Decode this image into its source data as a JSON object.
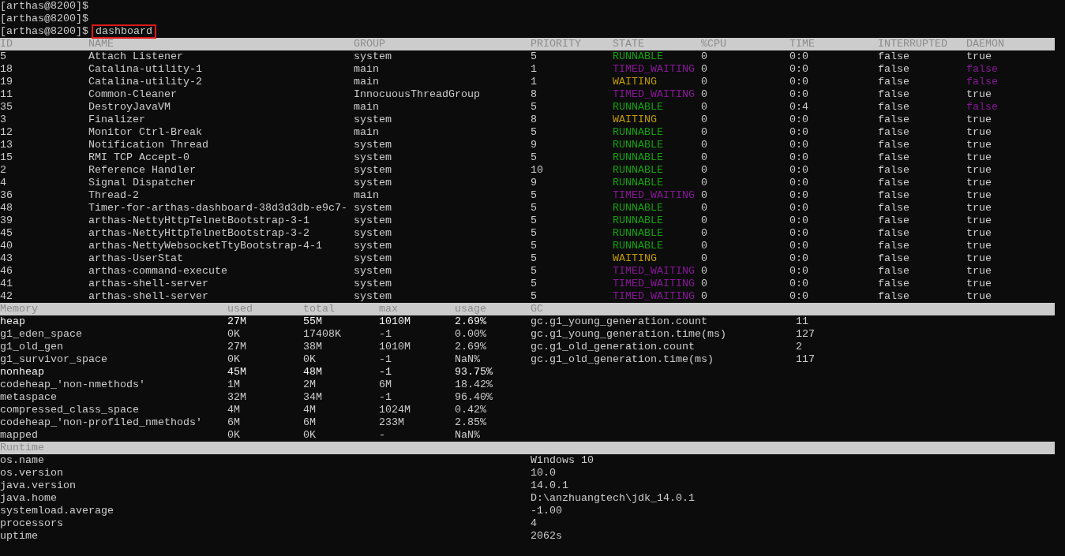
{
  "prompts": [
    {
      "prompt": "[arthas@8200]$"
    },
    {
      "prompt": "[arthas@8200]$"
    },
    {
      "prompt": "[arthas@8200]$",
      "command": "dashboard",
      "boxed": true
    }
  ],
  "threads": {
    "columns": [
      "ID",
      "NAME",
      "GROUP",
      "PRIORITY",
      "STATE",
      "%CPU",
      "TIME",
      "INTERRUPTED",
      "DAEMON"
    ],
    "rows": [
      {
        "id": "5",
        "name": "Attach Listener",
        "group": "system",
        "priority": "5",
        "state": {
          "text": "RUNNABLE",
          "color": "#13a10e"
        },
        "cpu": "0",
        "time": "0:0",
        "interrupted": "false",
        "daemon": {
          "text": "true",
          "color": "#cccccc"
        }
      },
      {
        "id": "18",
        "name": "Catalina-utility-1",
        "group": "main",
        "priority": "1",
        "state": {
          "text": "TIMED_WAITING",
          "color": "#881798"
        },
        "cpu": "0",
        "time": "0:0",
        "interrupted": "false",
        "daemon": {
          "text": "false",
          "color": "#881798"
        }
      },
      {
        "id": "19",
        "name": "Catalina-utility-2",
        "group": "main",
        "priority": "1",
        "state": {
          "text": "WAITING",
          "color": "#c19c00"
        },
        "cpu": "0",
        "time": "0:0",
        "interrupted": "false",
        "daemon": {
          "text": "false",
          "color": "#881798"
        }
      },
      {
        "id": "11",
        "name": "Common-Cleaner",
        "group": "InnocuousThreadGroup",
        "priority": "8",
        "state": {
          "text": "TIMED_WAITING",
          "color": "#881798"
        },
        "cpu": "0",
        "time": "0:0",
        "interrupted": "false",
        "daemon": {
          "text": "true",
          "color": "#cccccc"
        }
      },
      {
        "id": "35",
        "name": "DestroyJavaVM",
        "group": "main",
        "priority": "5",
        "state": {
          "text": "RUNNABLE",
          "color": "#13a10e"
        },
        "cpu": "0",
        "time": "0:4",
        "interrupted": "false",
        "daemon": {
          "text": "false",
          "color": "#881798"
        }
      },
      {
        "id": "3",
        "name": "Finalizer",
        "group": "system",
        "priority": "8",
        "state": {
          "text": "WAITING",
          "color": "#c19c00"
        },
        "cpu": "0",
        "time": "0:0",
        "interrupted": "false",
        "daemon": {
          "text": "true",
          "color": "#cccccc"
        }
      },
      {
        "id": "12",
        "name": "Monitor Ctrl-Break",
        "group": "main",
        "priority": "5",
        "state": {
          "text": "RUNNABLE",
          "color": "#13a10e"
        },
        "cpu": "0",
        "time": "0:0",
        "interrupted": "false",
        "daemon": {
          "text": "true",
          "color": "#cccccc"
        }
      },
      {
        "id": "13",
        "name": "Notification Thread",
        "group": "system",
        "priority": "9",
        "state": {
          "text": "RUNNABLE",
          "color": "#13a10e"
        },
        "cpu": "0",
        "time": "0:0",
        "interrupted": "false",
        "daemon": {
          "text": "true",
          "color": "#cccccc"
        }
      },
      {
        "id": "15",
        "name": "RMI TCP Accept-0",
        "group": "system",
        "priority": "5",
        "state": {
          "text": "RUNNABLE",
          "color": "#13a10e"
        },
        "cpu": "0",
        "time": "0:0",
        "interrupted": "false",
        "daemon": {
          "text": "true",
          "color": "#cccccc"
        }
      },
      {
        "id": "2",
        "name": "Reference Handler",
        "group": "system",
        "priority": "10",
        "state": {
          "text": "RUNNABLE",
          "color": "#13a10e"
        },
        "cpu": "0",
        "time": "0:0",
        "interrupted": "false",
        "daemon": {
          "text": "true",
          "color": "#cccccc"
        }
      },
      {
        "id": "4",
        "name": "Signal Dispatcher",
        "group": "system",
        "priority": "9",
        "state": {
          "text": "RUNNABLE",
          "color": "#13a10e"
        },
        "cpu": "0",
        "time": "0:0",
        "interrupted": "false",
        "daemon": {
          "text": "true",
          "color": "#cccccc"
        }
      },
      {
        "id": "36",
        "name": "Thread-2",
        "group": "main",
        "priority": "5",
        "state": {
          "text": "TIMED_WAITING",
          "color": "#881798"
        },
        "cpu": "0",
        "time": "0:0",
        "interrupted": "false",
        "daemon": {
          "text": "true",
          "color": "#cccccc"
        }
      },
      {
        "id": "48",
        "name": "Timer-for-arthas-dashboard-38d3d3db-e9c7-",
        "group": "system",
        "priority": "5",
        "state": {
          "text": "RUNNABLE",
          "color": "#13a10e"
        },
        "cpu": "0",
        "time": "0:0",
        "interrupted": "false",
        "daemon": {
          "text": "true",
          "color": "#cccccc"
        }
      },
      {
        "id": "39",
        "name": "arthas-NettyHttpTelnetBootstrap-3-1",
        "group": "system",
        "priority": "5",
        "state": {
          "text": "RUNNABLE",
          "color": "#13a10e"
        },
        "cpu": "0",
        "time": "0:0",
        "interrupted": "false",
        "daemon": {
          "text": "true",
          "color": "#cccccc"
        }
      },
      {
        "id": "45",
        "name": "arthas-NettyHttpTelnetBootstrap-3-2",
        "group": "system",
        "priority": "5",
        "state": {
          "text": "RUNNABLE",
          "color": "#13a10e"
        },
        "cpu": "0",
        "time": "0:0",
        "interrupted": "false",
        "daemon": {
          "text": "true",
          "color": "#cccccc"
        }
      },
      {
        "id": "40",
        "name": "arthas-NettyWebsocketTtyBootstrap-4-1",
        "group": "system",
        "priority": "5",
        "state": {
          "text": "RUNNABLE",
          "color": "#13a10e"
        },
        "cpu": "0",
        "time": "0:0",
        "interrupted": "false",
        "daemon": {
          "text": "true",
          "color": "#cccccc"
        }
      },
      {
        "id": "43",
        "name": "arthas-UserStat",
        "group": "system",
        "priority": "5",
        "state": {
          "text": "WAITING",
          "color": "#c19c00"
        },
        "cpu": "0",
        "time": "0:0",
        "interrupted": "false",
        "daemon": {
          "text": "true",
          "color": "#cccccc"
        }
      },
      {
        "id": "46",
        "name": "arthas-command-execute",
        "group": "system",
        "priority": "5",
        "state": {
          "text": "TIMED_WAITING",
          "color": "#881798"
        },
        "cpu": "0",
        "time": "0:0",
        "interrupted": "false",
        "daemon": {
          "text": "true",
          "color": "#cccccc"
        }
      },
      {
        "id": "41",
        "name": "arthas-shell-server",
        "group": "system",
        "priority": "5",
        "state": {
          "text": "TIMED_WAITING",
          "color": "#881798"
        },
        "cpu": "0",
        "time": "0:0",
        "interrupted": "false",
        "daemon": {
          "text": "true",
          "color": "#cccccc"
        }
      },
      {
        "id": "42",
        "name": "arthas-shell-server",
        "group": "system",
        "priority": "5",
        "state": {
          "text": "TIMED_WAITING",
          "color": "#881798"
        },
        "cpu": "0",
        "time": "0:0",
        "interrupted": "false",
        "daemon": {
          "text": "true",
          "color": "#cccccc"
        }
      }
    ]
  },
  "memory": {
    "columns": [
      "Memory",
      "used",
      "total",
      "max",
      "usage"
    ],
    "rows": [
      {
        "name": "heap",
        "used": "27M",
        "total": "55M",
        "max": "1010M",
        "usage": "2.69%",
        "highlight": true
      },
      {
        "name": "g1_eden_space",
        "used": "0K",
        "total": "17408K",
        "max": "-1",
        "usage": "0.00%",
        "highlight": false
      },
      {
        "name": "g1_old_gen",
        "used": "27M",
        "total": "38M",
        "max": "1010M",
        "usage": "2.69%",
        "highlight": false
      },
      {
        "name": "g1_survivor_space",
        "used": "0K",
        "total": "0K",
        "max": "-1",
        "usage": "NaN%",
        "highlight": false
      },
      {
        "name": "nonheap",
        "used": "45M",
        "total": "48M",
        "max": "-1",
        "usage": "93.75%",
        "highlight": true
      },
      {
        "name": "codeheap_'non-nmethods'",
        "used": "1M",
        "total": "2M",
        "max": "6M",
        "usage": "18.42%",
        "highlight": false
      },
      {
        "name": "metaspace",
        "used": "32M",
        "total": "34M",
        "max": "-1",
        "usage": "96.40%",
        "highlight": false
      },
      {
        "name": "compressed_class_space",
        "used": "4M",
        "total": "4M",
        "max": "1024M",
        "usage": "0.42%",
        "highlight": false
      },
      {
        "name": "codeheap_'non-profiled_nmethods'",
        "used": "6M",
        "total": "6M",
        "max": "233M",
        "usage": "2.85%",
        "highlight": false
      },
      {
        "name": "mapped",
        "used": "0K",
        "total": "0K",
        "max": "-",
        "usage": "NaN%",
        "highlight": false
      }
    ]
  },
  "gc": {
    "title": "GC",
    "rows": [
      {
        "name": "gc.g1_young_generation.count",
        "value": "11"
      },
      {
        "name": "gc.g1_young_generation.time(ms)",
        "value": "127"
      },
      {
        "name": "gc.g1_old_generation.count",
        "value": "2"
      },
      {
        "name": "gc.g1_old_generation.time(ms)",
        "value": "117"
      }
    ]
  },
  "runtime": {
    "title": "Runtime",
    "rows": [
      {
        "name": "os.name",
        "value": "Windows 10"
      },
      {
        "name": "os.version",
        "value": "10.0"
      },
      {
        "name": "java.version",
        "value": "14.0.1"
      },
      {
        "name": "java.home",
        "value": "D:\\anzhuangtech\\jdk_14.0.1"
      },
      {
        "name": "systemload.average",
        "value": "-1.00"
      },
      {
        "name": "processors",
        "value": "4"
      },
      {
        "name": "uptime",
        "value": "2062s"
      }
    ]
  }
}
